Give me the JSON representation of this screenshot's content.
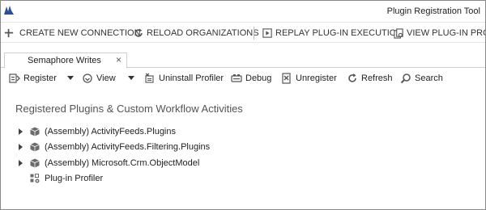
{
  "window": {
    "title": "Plugin Registration Tool",
    "logo_icon": "dynamics-logo-icon"
  },
  "main_toolbar": {
    "items": [
      {
        "label": "CREATE NEW CONNECTION",
        "icon": "plus-icon"
      },
      {
        "label": "RELOAD ORGANIZATIONS",
        "icon": "reload-icon"
      },
      {
        "label": "REPLAY PLUG-IN EXECUTION",
        "icon": "replay-icon"
      },
      {
        "label": "VIEW PLUG-IN PROFIL",
        "icon": "view-profile-icon"
      }
    ]
  },
  "tabs": [
    {
      "label": "Semaphore Writes",
      "close": "×"
    }
  ],
  "sub_toolbar": {
    "items": [
      {
        "label": "Register",
        "icon": "register-icon",
        "has_dropdown": true
      },
      {
        "label": "View",
        "icon": "view-icon",
        "has_dropdown": true
      },
      {
        "label": "Uninstall Profiler",
        "icon": "uninstall-profiler-icon"
      },
      {
        "label": "Debug",
        "icon": "debug-icon"
      },
      {
        "label": "Unregister",
        "icon": "unregister-icon"
      },
      {
        "label": "Refresh",
        "icon": "refresh-icon"
      },
      {
        "label": "Search",
        "icon": "search-icon"
      }
    ]
  },
  "content": {
    "section_title": "Registered Plugins & Custom Workflow Activities",
    "tree": [
      {
        "label": "(Assembly) ActivityFeeds.Plugins",
        "expandable": true,
        "icon": "assembly-icon"
      },
      {
        "label": "(Assembly) ActivityFeeds.Filtering.Plugins",
        "expandable": true,
        "icon": "assembly-icon"
      },
      {
        "label": "(Assembly) Microsoft.Crm.ObjectModel",
        "expandable": true,
        "icon": "assembly-icon"
      },
      {
        "label": "Plug-in Profiler",
        "expandable": false,
        "icon": "profiler-icon"
      }
    ]
  },
  "colors": {
    "logo": "#2a4f9c",
    "border": "#888888",
    "text": "#222222",
    "section_title": "#555555"
  }
}
